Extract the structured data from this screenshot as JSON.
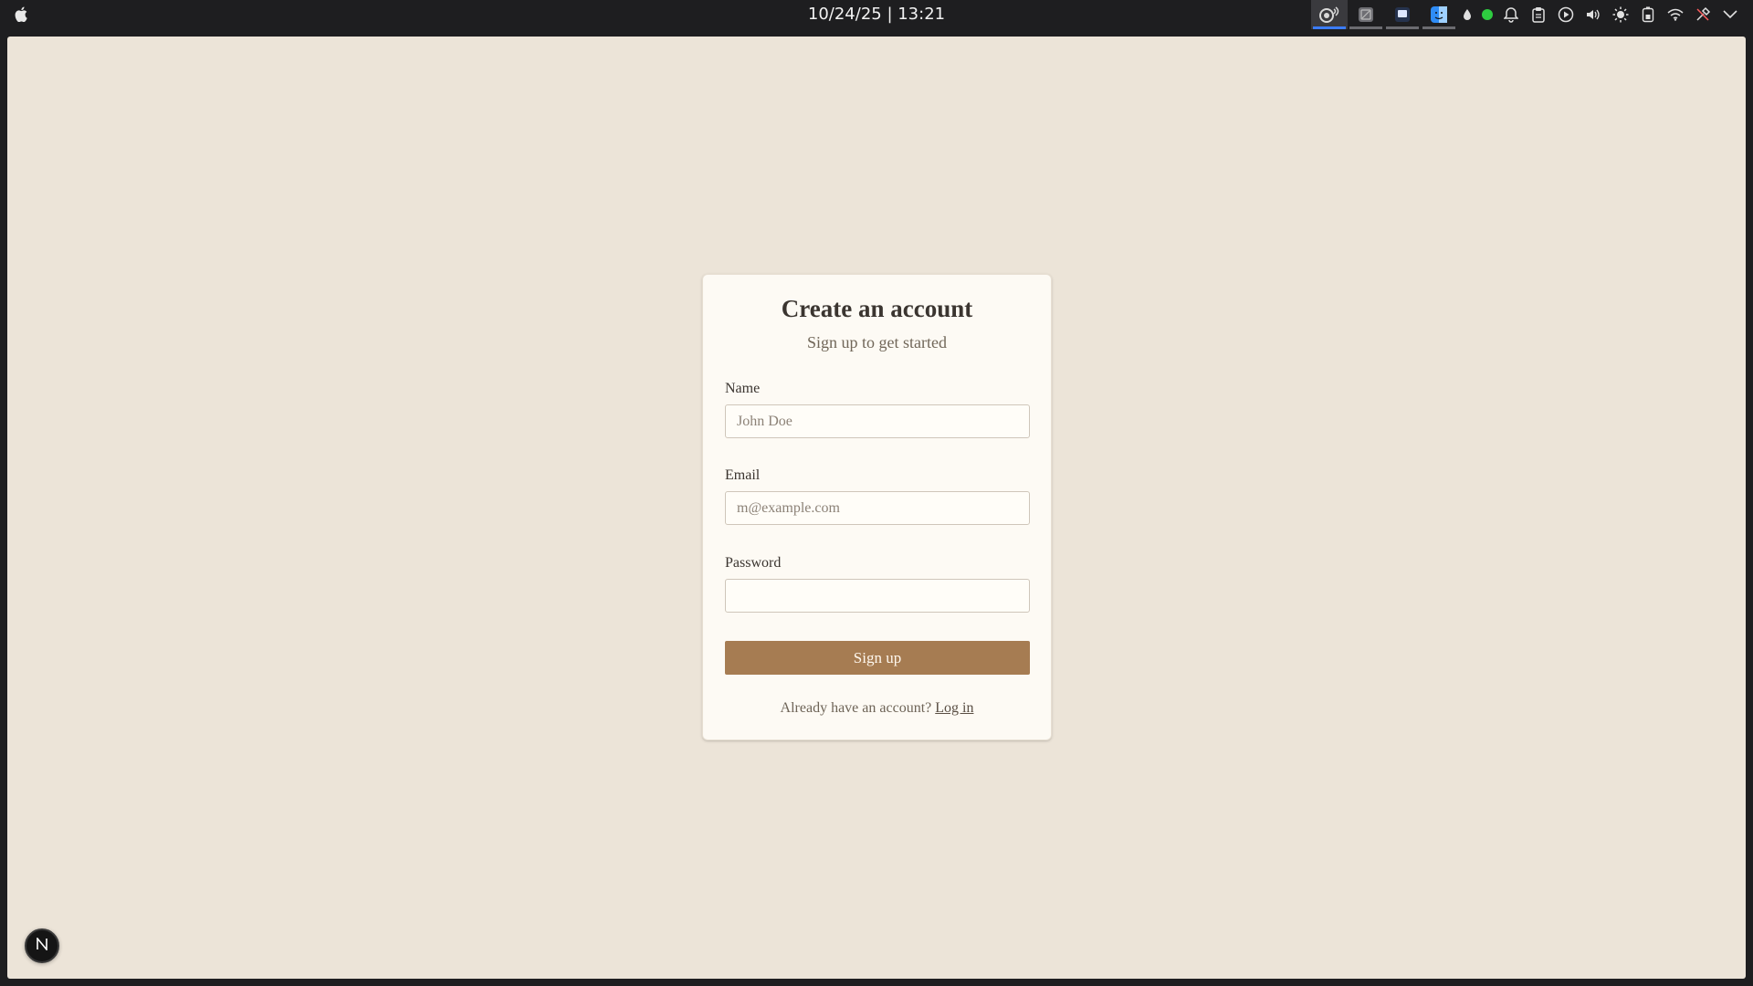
{
  "system_bar": {
    "datetime": "10/24/25 | 13:21",
    "tray_icons": [
      "screen-recorder-icon",
      "app-window-icon",
      "app-window-icon",
      "finder-icon",
      "droplet-icon",
      "status-dot-icon",
      "bell-icon",
      "clipboard-icon",
      "play-icon",
      "volume-icon",
      "brightness-icon",
      "battery-icon",
      "wifi-icon",
      "tools-icon",
      "chevron-down-icon"
    ],
    "status_dot_color": "#2ecc40"
  },
  "page": {
    "background": "#ece4d8"
  },
  "signup": {
    "title": "Create an account",
    "subtitle": "Sign up to get started",
    "name_label": "Name",
    "name_placeholder": "John Doe",
    "name_value": "",
    "email_label": "Email",
    "email_placeholder": "m@example.com",
    "email_value": "",
    "password_label": "Password",
    "password_value": "",
    "submit_label": "Sign up",
    "submit_color": "#a67c52",
    "footer_text": "Already have an account?",
    "login_link": "Log in"
  },
  "dev_badge": {
    "letter": "N"
  }
}
